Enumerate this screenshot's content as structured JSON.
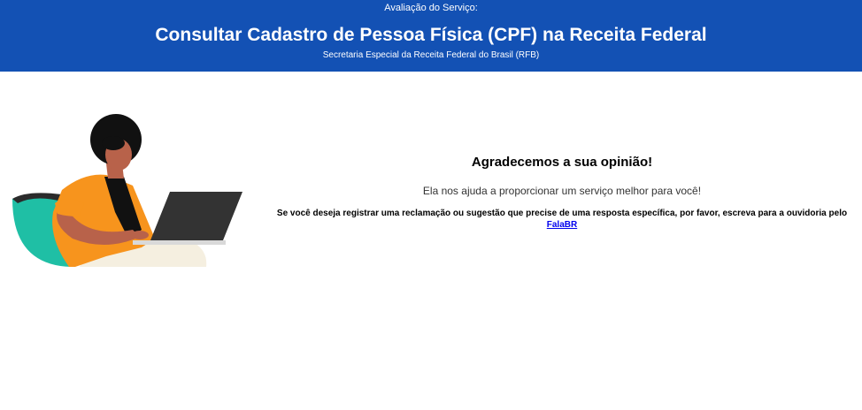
{
  "header": {
    "eyebrow": "Avaliação do Serviço:",
    "title": "Consultar Cadastro de Pessoa Física (CPF) na Receita Federal",
    "subtitle": "Secretaria Especial da Receita Federal do Brasil (RFB)"
  },
  "main": {
    "thanks": "Agradecemos a sua opinião!",
    "help": "Ela nos ajuda a proporcionar um serviço melhor para você!",
    "note": "Se você deseja registrar uma reclamação ou sugestão que precise de uma resposta específica, por favor, escreva para a ouvidoria pelo",
    "link_label": "FalaBR"
  },
  "colors": {
    "header_bg": "#1351b4",
    "link": "#0000ee",
    "illustration_teal": "#1fbfa5",
    "illustration_orange": "#f7941d",
    "illustration_skin": "#b8624a"
  }
}
